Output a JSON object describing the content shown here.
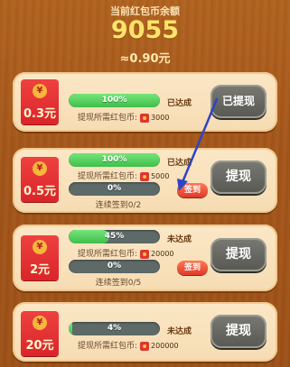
{
  "header": {
    "label": "当前红包币余额",
    "coins": "9055",
    "rmb": "≈0.90元"
  },
  "cards": [
    {
      "amount": "0.3元",
      "coin_symbol": "¥",
      "progress_label": "100%",
      "progress": 1.0,
      "status": "已达成",
      "requirement_label": "提现所需红包币:",
      "requirement_value": "3000",
      "button_label": "已提现"
    },
    {
      "amount": "0.5元",
      "coin_symbol": "¥",
      "progress_label": "100%",
      "progress": 1.0,
      "status": "已达成",
      "requirement_label": "提现所需红包币:",
      "requirement_value": "5000",
      "streak_progress_label": "0%",
      "streak_progress": 0.0,
      "streak_label": "连续签到0/2",
      "sign_label": "签到",
      "button_label": "提现"
    },
    {
      "amount": "2元",
      "coin_symbol": "¥",
      "progress_label": "45%",
      "progress": 0.45,
      "status": "未达成",
      "requirement_label": "提现所需红包币:",
      "requirement_value": "20000",
      "streak_progress_label": "0%",
      "streak_progress": 0.0,
      "streak_label": "连续签到0/5",
      "sign_label": "签到",
      "button_label": "提现"
    },
    {
      "amount": "20元",
      "coin_symbol": "¥",
      "progress_label": "4%",
      "progress": 0.04,
      "status": "未达成",
      "requirement_label": "提现所需红包币:",
      "requirement_value": "200000",
      "button_label": "提现"
    }
  ],
  "colors": {
    "background": "#a4561a",
    "card": "#f8e0b8",
    "progress_fill": "#4cc856",
    "progress_track": "#5d6a68",
    "red_packet": "#e0302f",
    "button": "#66665f",
    "sign_button": "#ef5535",
    "arrow": "#2f43c8"
  }
}
